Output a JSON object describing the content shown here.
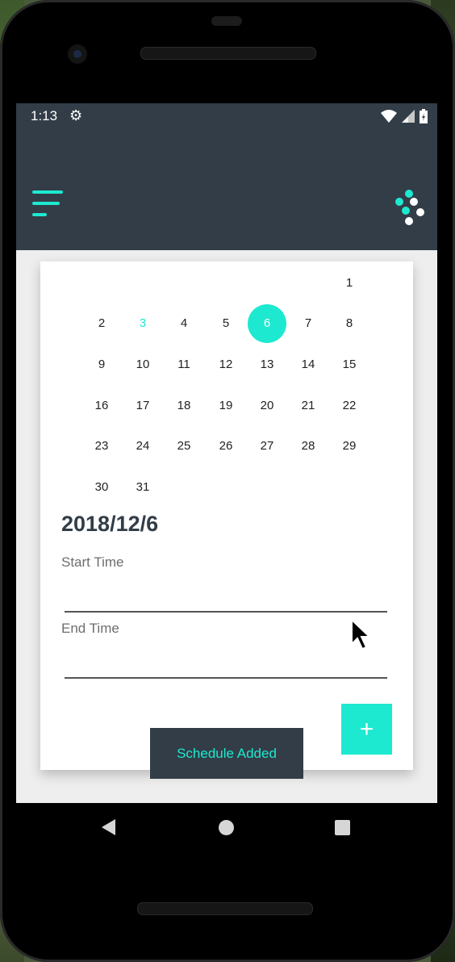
{
  "status_bar": {
    "time": "1:13",
    "gear_icon": "gear-icon",
    "wifi_icon": "wifi-icon",
    "signal_icon": "signal-icon",
    "battery_icon": "battery-icon"
  },
  "app_bar": {
    "menu_icon": "menu-icon",
    "logo_icon": "dots-logo-icon",
    "background_color": "#323d47",
    "accent_color": "#1de9d0"
  },
  "calendar": {
    "rows": [
      [
        "",
        "",
        "",
        "",
        "",
        "",
        "1"
      ],
      [
        "2",
        "3",
        "4",
        "5",
        "6",
        "7",
        "8"
      ],
      [
        "9",
        "10",
        "11",
        "12",
        "13",
        "14",
        "15"
      ],
      [
        "16",
        "17",
        "18",
        "19",
        "20",
        "21",
        "22"
      ],
      [
        "23",
        "24",
        "25",
        "26",
        "27",
        "28",
        "29"
      ],
      [
        "30",
        "31",
        "",
        "",
        "",
        "",
        ""
      ]
    ],
    "today": "3",
    "selected": "6"
  },
  "selected_date": "2018/12/6",
  "form": {
    "start_time_label": "Start Time",
    "start_time_value": "",
    "end_time_label": "End Time",
    "end_time_value": ""
  },
  "fab": {
    "label": "+"
  },
  "toast": {
    "message": "Schedule Added"
  }
}
